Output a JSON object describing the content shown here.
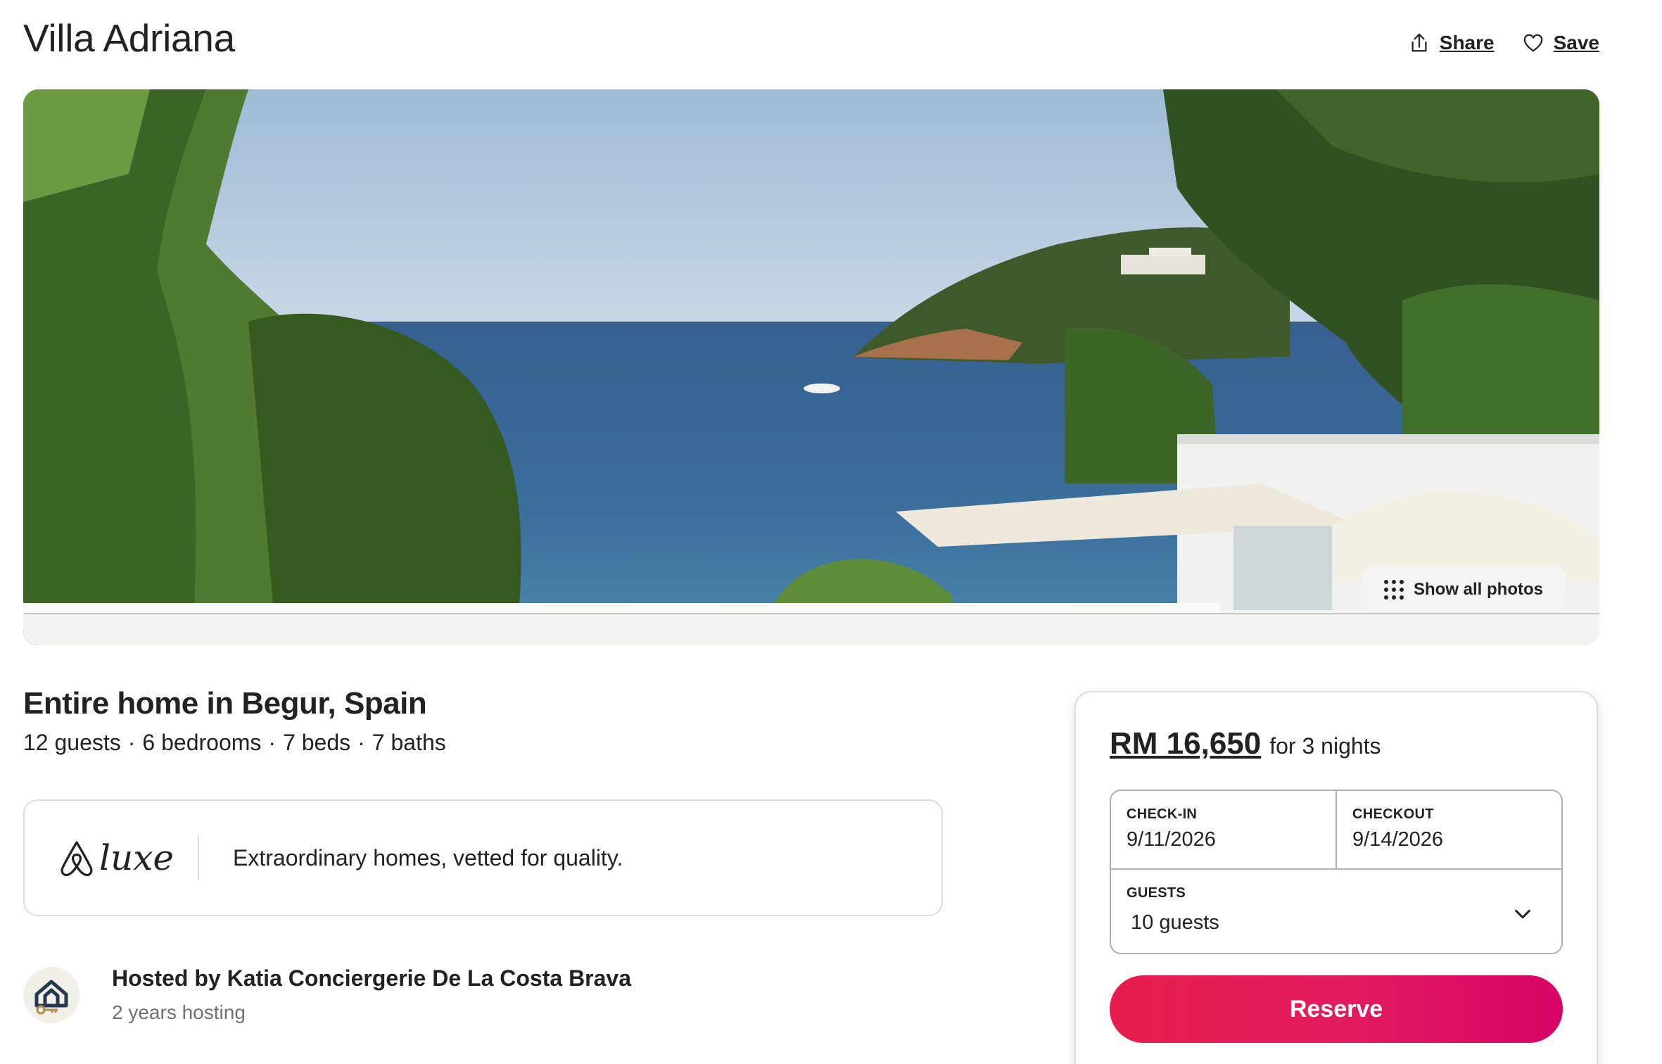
{
  "header": {
    "title": "Villa Adriana",
    "share_label": "Share",
    "save_label": "Save"
  },
  "gallery": {
    "show_all_label": "Show all photos"
  },
  "listing": {
    "type_location": "Entire home in Begur, Spain",
    "specs": [
      "12 guests",
      "·",
      "6 bedrooms",
      "·",
      "7 beds",
      "·",
      "7 baths"
    ]
  },
  "luxe": {
    "logo_text": "luxe",
    "tagline": "Extraordinary homes, vetted for quality."
  },
  "host": {
    "name_line": "Hosted by Katia Conciergerie De La Costa Brava",
    "tenure": "2 years hosting"
  },
  "booking": {
    "price": "RM 16,650",
    "price_suffix": "for 3 nights",
    "checkin_label": "CHECK-IN",
    "checkin_value": "9/11/2026",
    "checkout_label": "CHECKOUT",
    "checkout_value": "9/14/2026",
    "guests_label": "GUESTS",
    "guests_value": "10 guests",
    "reserve_label": "Reserve"
  },
  "colors": {
    "brand": "#e31c5f",
    "text": "#222222",
    "muted": "#717171",
    "border": "#dddddd"
  },
  "icons": [
    "share-icon",
    "heart-icon",
    "grid-dots-icon",
    "airbnb-logo-icon",
    "chevron-down-icon",
    "host-house-key-icon"
  ]
}
